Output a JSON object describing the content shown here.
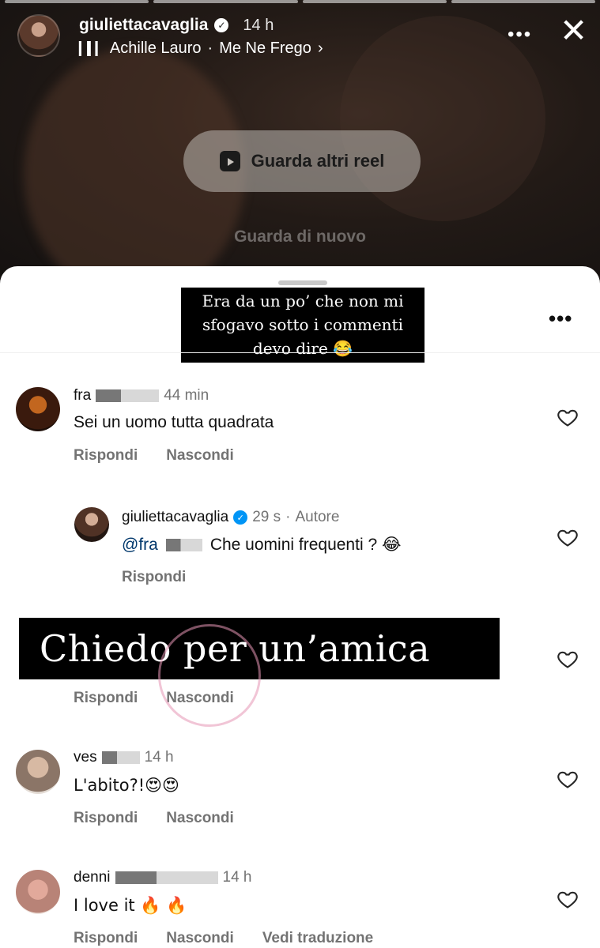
{
  "story": {
    "username": "giuliettacavaglia",
    "time": "14 h",
    "music_artist": "Achille Lauro",
    "music_separator": "·",
    "music_track": "Me Ne Frego",
    "more_icon": "more-horizontal-icon",
    "close_icon": "close-icon",
    "reel_button_label": "Guarda altri reel",
    "rewatch_label": "Guarda di nuovo"
  },
  "sheet": {
    "caption_lines": [
      "Era da un po’ che non mi",
      "sfogavo sotto i commenti",
      "devo dire 😂"
    ]
  },
  "comments": [
    {
      "username": "fra",
      "time": "44 min",
      "text": "Sei un uomo tutta quadrata",
      "reply_label": "Rispondi",
      "hide_label": "Nascondi"
    },
    {
      "username": "giuliettacavaglia",
      "time": "29 s",
      "separator": "·",
      "author_tag": "Autore",
      "mention": "@fra",
      "text": "Che uomini frequenti ? 😂",
      "reply_label": "Rispondi"
    },
    {
      "reply_label": "Rispondi",
      "hide_label": "Nascondi"
    },
    {
      "username": "ves",
      "time": "14 h",
      "text": "L'abito?!😍😍",
      "reply_label": "Rispondi",
      "hide_label": "Nascondi"
    },
    {
      "username": "denni",
      "time": "14 h",
      "text": "I love it 🔥 🔥",
      "reply_label": "Rispondi",
      "hide_label": "Nascondi",
      "translate_label": "Vedi traduzione"
    }
  ],
  "overlay_text": "Chiedo per un’amica",
  "colors": {
    "verified": "#0095f6",
    "meta_gray": "#737373",
    "mention": "#00376b"
  }
}
